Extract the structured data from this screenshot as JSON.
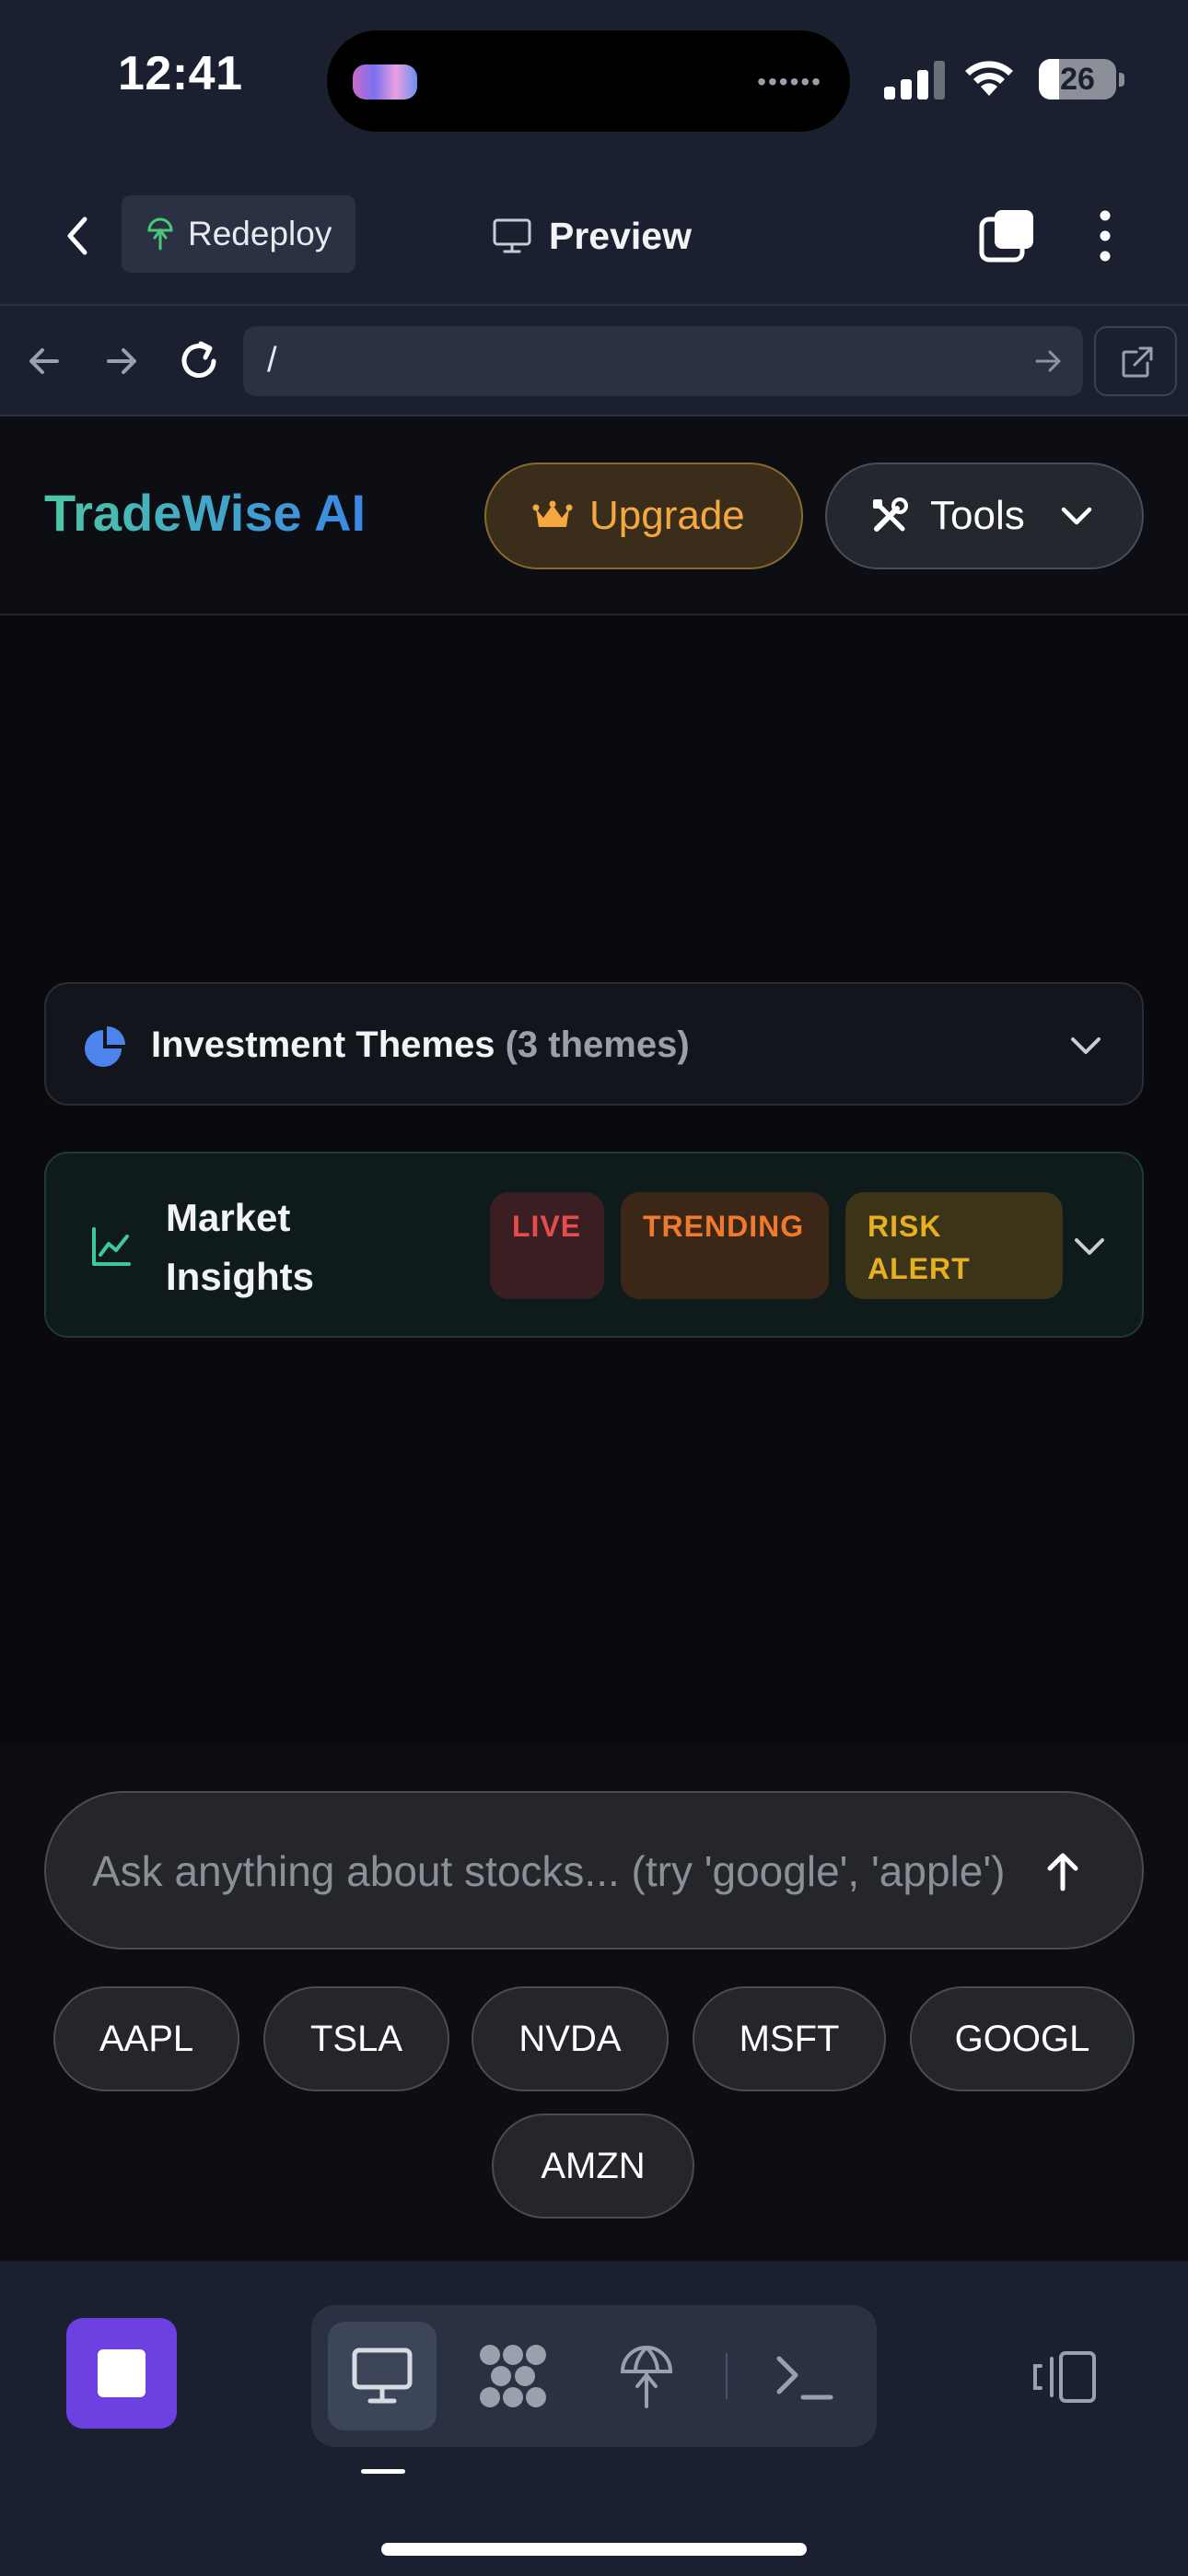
{
  "status_bar": {
    "time": "12:41",
    "battery": "26",
    "battery_level_percent": 26
  },
  "app_header": {
    "redeploy_label": "Redeploy",
    "title": "Preview"
  },
  "browser": {
    "url": "/"
  },
  "site": {
    "brand": "TradeWise AI",
    "upgrade_label": "Upgrade",
    "tools_label": "Tools"
  },
  "themes": {
    "title": "Investment Themes",
    "count": "(3 themes)"
  },
  "insights": {
    "title": "Market Insights",
    "badges": {
      "live": "LIVE",
      "trending": "TRENDING",
      "risk": "RISK ALERT"
    }
  },
  "composer": {
    "placeholder": "Ask anything about stocks... (try 'google', 'apple')",
    "tickers": [
      "AAPL",
      "TSLA",
      "NVDA",
      "MSFT",
      "GOOGL",
      "AMZN"
    ]
  },
  "colors": {
    "accent_purple": "#6d40e0",
    "brand_gradient_start": "#4cc7a4",
    "brand_gradient_end": "#3b87e6",
    "upgrade_orange": "#f5a742",
    "live_red": "#e54d4d",
    "trending_orange": "#f07a2b",
    "risk_yellow": "#e6b020"
  },
  "icons": [
    "signal-icon",
    "wifi-icon",
    "battery-icon",
    "back-icon",
    "redeploy-icon",
    "monitor-icon",
    "tabs-icon",
    "more-icon",
    "arrow-left-icon",
    "arrow-right-icon",
    "reload-icon",
    "go-arrow-icon",
    "external-link-icon",
    "crown-icon",
    "tools-icon",
    "chevron-down-icon",
    "pie-chart-icon",
    "line-chart-icon",
    "arrow-up-icon",
    "stop-icon",
    "preview-mode-icon",
    "components-icon",
    "deploy-icon",
    "terminal-icon",
    "device-toggle-icon"
  ]
}
